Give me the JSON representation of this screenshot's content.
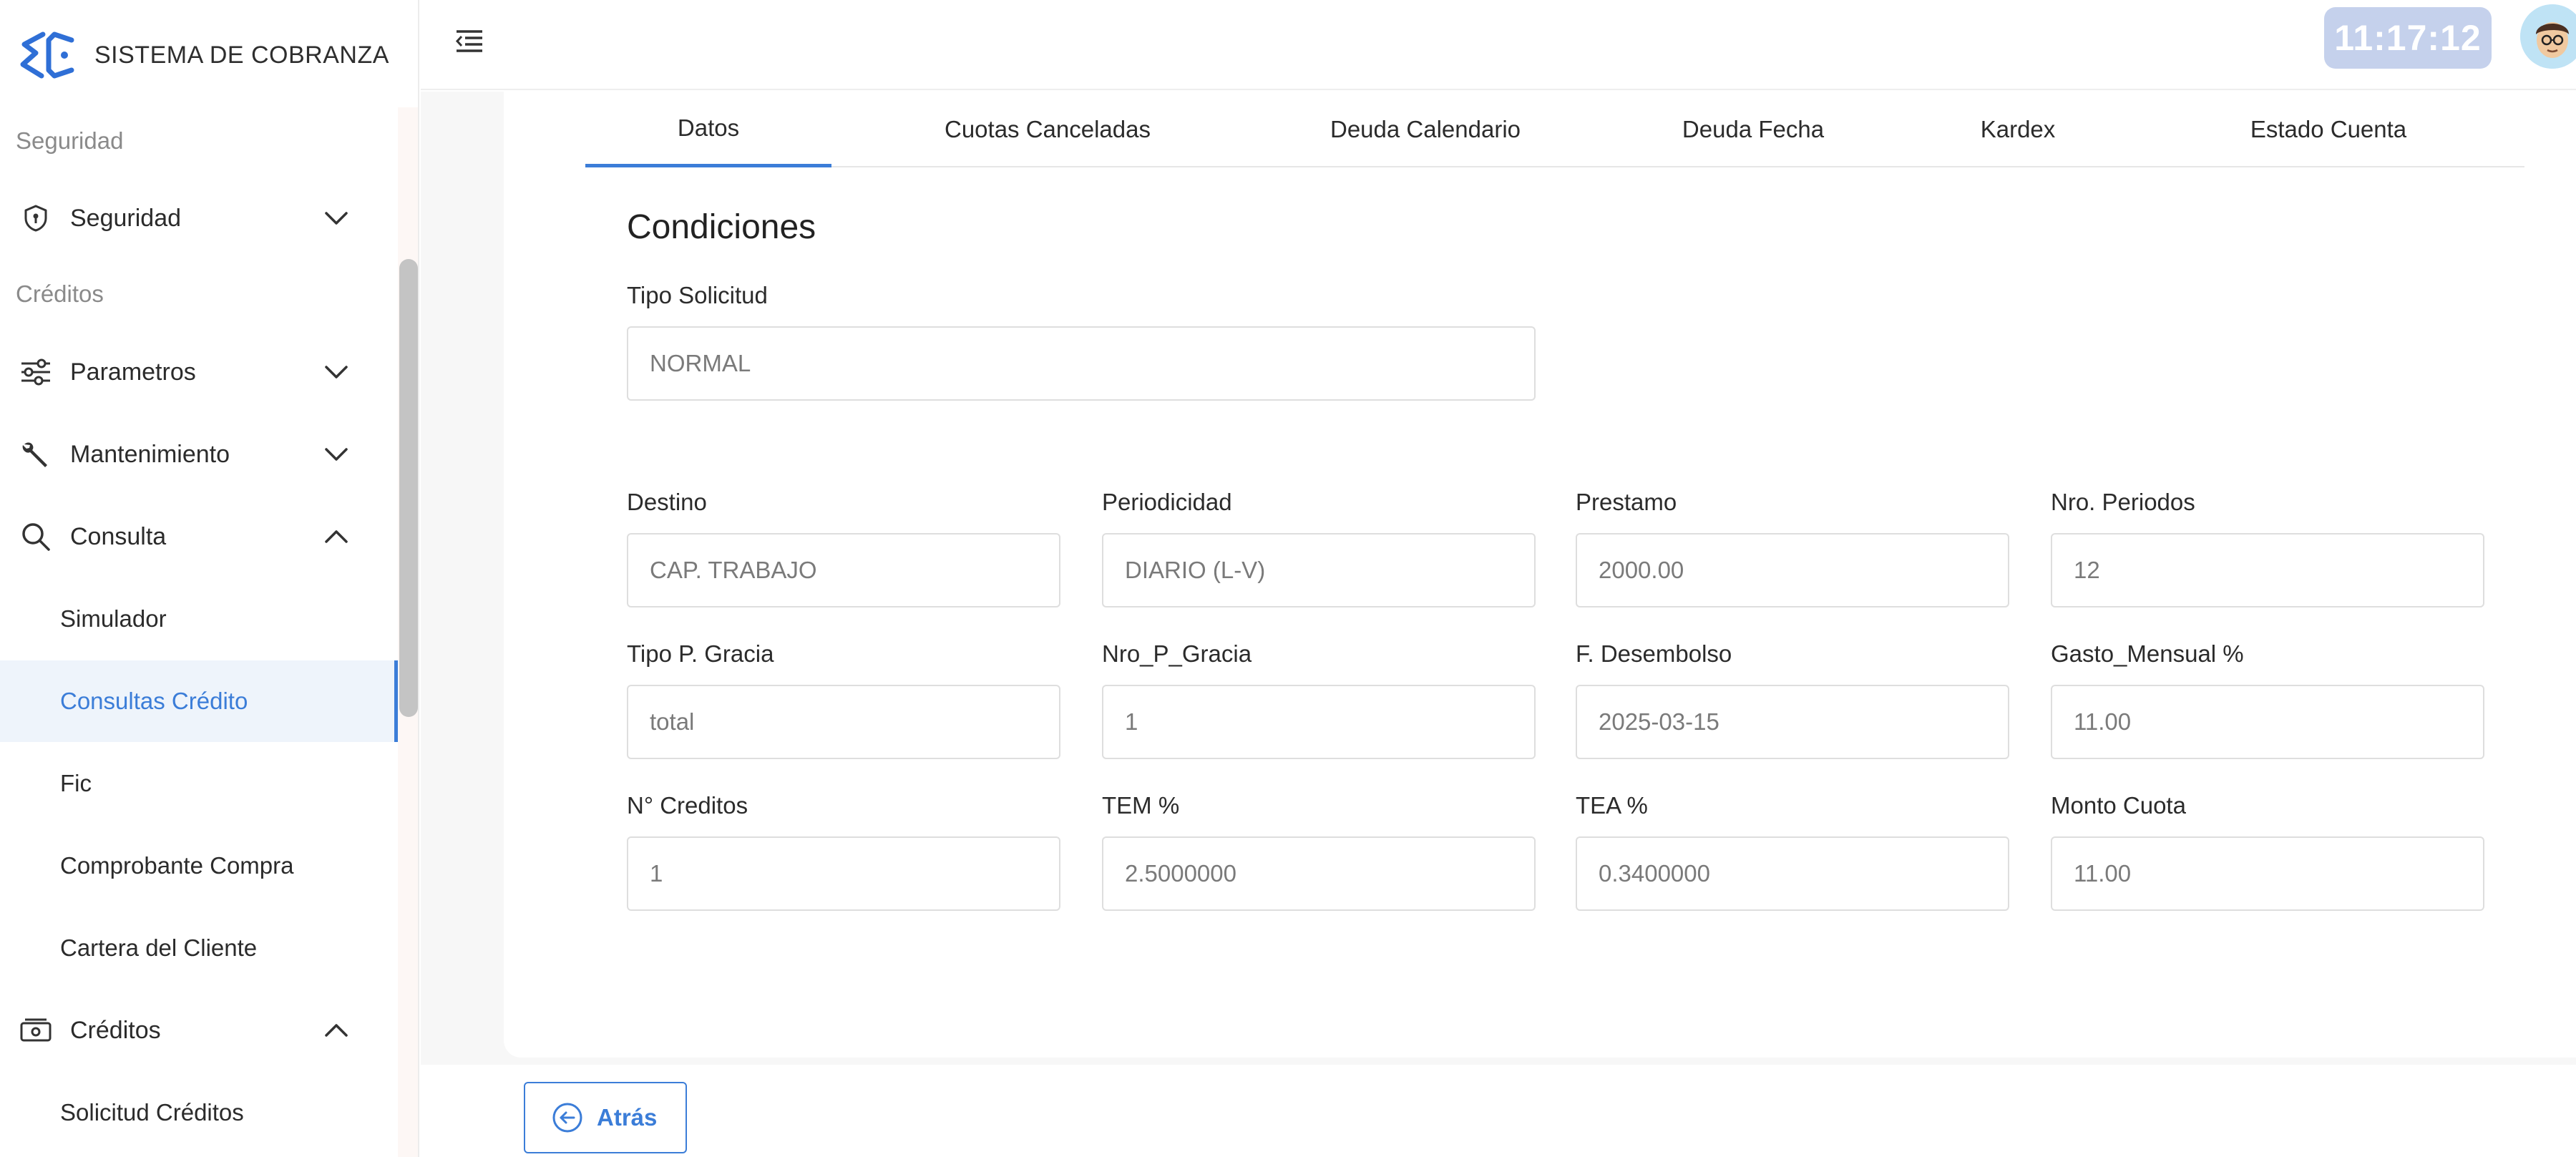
{
  "app": {
    "title": "SISTEMA DE COBRANZA"
  },
  "sidebar": {
    "sections": [
      {
        "title": "Seguridad"
      },
      {
        "title": "Créditos"
      }
    ],
    "items": [
      {
        "label": "Seguridad",
        "icon": "shield-icon",
        "expanded": false
      },
      {
        "label": "Parametros",
        "icon": "sliders-icon",
        "expanded": false
      },
      {
        "label": "Mantenimiento",
        "icon": "wrench-icon",
        "expanded": false
      },
      {
        "label": "Consulta",
        "icon": "search-icon",
        "expanded": true
      },
      {
        "label": "Créditos",
        "icon": "cash-icon",
        "expanded": true
      }
    ],
    "subitems": [
      {
        "label": "Simulador"
      },
      {
        "label": "Consultas Crédito",
        "active": true
      },
      {
        "label": "Fic"
      },
      {
        "label": "Comprobante Compra"
      },
      {
        "label": "Cartera del Cliente"
      },
      {
        "label": "Solicitud Créditos"
      }
    ]
  },
  "header": {
    "clock": "11:17:12"
  },
  "tabs": [
    {
      "label": "Datos",
      "active": true
    },
    {
      "label": "Cuotas Canceladas"
    },
    {
      "label": "Deuda Calendario"
    },
    {
      "label": "Deuda Fecha"
    },
    {
      "label": "Kardex"
    },
    {
      "label": "Estado Cuenta"
    }
  ],
  "form": {
    "heading": "Condiciones",
    "tipo_solicitud": {
      "label": "Tipo Solicitud",
      "value": "NORMAL"
    },
    "fields": [
      {
        "label": "Destino",
        "value": "CAP. TRABAJO"
      },
      {
        "label": "Periodicidad",
        "value": "DIARIO (L-V)"
      },
      {
        "label": "Prestamo",
        "value": "2000.00"
      },
      {
        "label": "Nro. Periodos",
        "value": "12"
      },
      {
        "label": "Tipo P. Gracia",
        "value": "total"
      },
      {
        "label": "Nro_P_Gracia",
        "value": "1"
      },
      {
        "label": "F. Desembolso",
        "value": "2025-03-15"
      },
      {
        "label": "Gasto_Mensual %",
        "value": "11.00"
      },
      {
        "label": "N° Creditos",
        "value": "1"
      },
      {
        "label": "TEM %",
        "value": "2.5000000"
      },
      {
        "label": "TEA %",
        "value": "0.3400000"
      },
      {
        "label": "Monto Cuota",
        "value": "11.00"
      }
    ]
  },
  "footer": {
    "back_label": "Atrás"
  },
  "colors": {
    "accent": "#3b7dd8",
    "clock_bg": "#c5d1ec",
    "active_bg": "#eef4fb"
  }
}
